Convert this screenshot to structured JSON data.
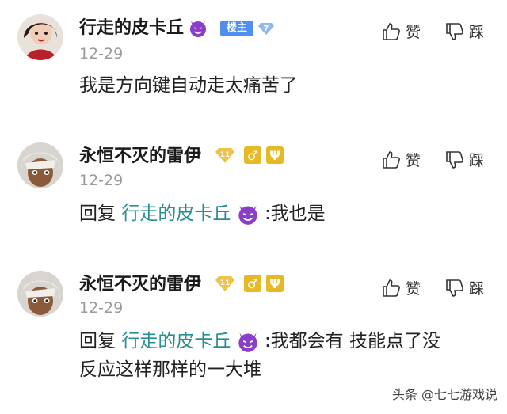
{
  "comments": [
    {
      "username": "行走的皮卡丘",
      "badge": "楼主",
      "level": "7",
      "date": "12-29",
      "text": "我是方向键自动走太痛苦了",
      "like_label": "赞",
      "dislike_label": "踩"
    },
    {
      "username": "永恒不灭的雷伊",
      "level": "11",
      "date": "12-29",
      "reply_prefix": "回复",
      "mention": "行走的皮卡丘",
      "text": ":我也是",
      "like_label": "赞",
      "dislike_label": "踩"
    },
    {
      "username": "永恒不灭的雷伊",
      "level": "11",
      "date": "12-29",
      "reply_prefix": "回复",
      "mention": "行走的皮卡丘",
      "text": ":我都会有 技能点了没",
      "text_line2": "反应这样那样的一大堆",
      "like_label": "赞",
      "dislike_label": "踩"
    }
  ],
  "watermark": "头条 @七七游戏说",
  "colors": {
    "mention": "#2a8f8f",
    "op_badge": "#4f8ff0",
    "gold_badge": "#e7b926",
    "devil_emoji": "#8b3fc9"
  },
  "icons": [
    "devil-emoji-icon",
    "thumbs-up-icon",
    "thumbs-down-icon",
    "diamond-level-icon",
    "male-symbol-icon",
    "psi-symbol-icon"
  ]
}
